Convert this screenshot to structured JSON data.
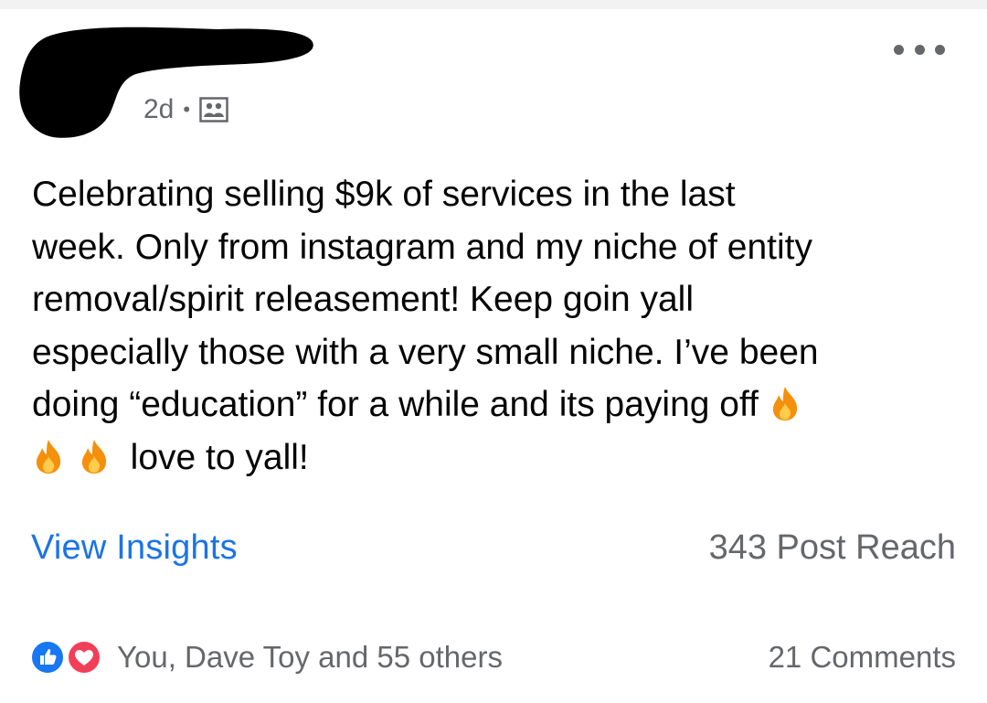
{
  "post": {
    "time": "2d",
    "separator": "•",
    "audience_icon": "group-audience-icon",
    "text": {
      "line1": "Celebrating selling $9k of services in the last",
      "line2": "week. Only from instagram and my niche of entity",
      "line3": "removal/spirit releasement! Keep goin yall",
      "line4": "especially those with a very small niche. I’ve been",
      "line5": "doing “education” for a while and its paying off",
      "line6_end": "love to yall!"
    },
    "emoji": "fire-emoji"
  },
  "insights": {
    "link_label": "View Insights",
    "reach_label": "343 Post Reach"
  },
  "engagement": {
    "reaction_icons": [
      "like-icon",
      "love-icon"
    ],
    "reactions_text": "You, Dave Toy and 55 others",
    "comments_text": "21 Comments"
  },
  "colors": {
    "link_blue": "#1b74e4",
    "meta_gray": "#65676b",
    "like_blue": "#1877f2",
    "love_red": "#f33e58"
  }
}
